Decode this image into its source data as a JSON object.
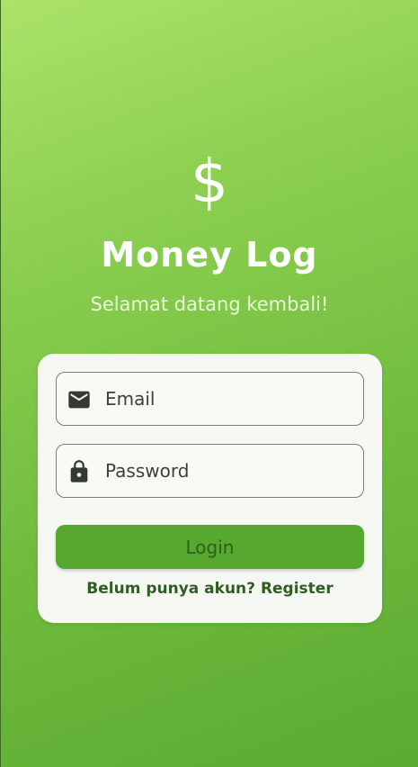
{
  "app": {
    "logo_symbol": "$",
    "title": "Money Log",
    "subtitle": "Selamat datang kembali!"
  },
  "form": {
    "email": {
      "placeholder": "Email",
      "value": "",
      "icon": "mail-icon"
    },
    "password": {
      "placeholder": "Password",
      "value": "",
      "icon": "lock-icon"
    },
    "login_label": "Login",
    "register_label": "Belum punya akun? Register"
  },
  "colors": {
    "gradient_top": "#ACE36A",
    "gradient_bottom": "#5AAA31",
    "card_background": "#F5F8F2",
    "button_background": "#57A82F",
    "button_text": "#2D5E1C",
    "link_text": "#315D25"
  }
}
